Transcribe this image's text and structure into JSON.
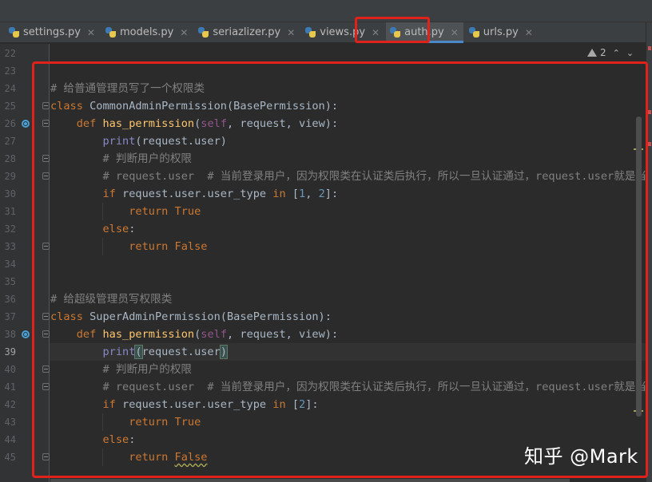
{
  "tabs": [
    {
      "label": "settings.py",
      "active": false
    },
    {
      "label": "models.py",
      "active": false
    },
    {
      "label": "seriazlizer.py",
      "active": false
    },
    {
      "label": "views.py",
      "active": false
    },
    {
      "label": "auth.py",
      "active": true
    },
    {
      "label": "urls.py",
      "active": false
    }
  ],
  "inspections": {
    "warning_count": "2"
  },
  "gutter": {
    "line_numbers": [
      "22",
      "23",
      "24",
      "25",
      "26",
      "27",
      "28",
      "29",
      "30",
      "31",
      "32",
      "33",
      "34",
      "35",
      "36",
      "37",
      "38",
      "39",
      "40",
      "41",
      "42",
      "43",
      "44",
      "45"
    ],
    "current_line": "39"
  },
  "code": {
    "l24": {
      "comment": "# 给普通管理员写了一个权限类"
    },
    "l25": {
      "kw": "class",
      "name": "CommonAdminPermission",
      "base": "(BasePermission):"
    },
    "l26": {
      "kw": "def",
      "fn": "has_permission",
      "p1": "self",
      "p2": ", request, view):"
    },
    "l27": {
      "bi": "print",
      "args": "(request.user)"
    },
    "l28": {
      "comment": "# 判断用户的权限"
    },
    "l29": {
      "comment": "# request.user  # 当前登录用户，因为权限类在认证类后执行，所以一旦认证通过，request.user就是当前登"
    },
    "l30": {
      "kw": "if",
      "expr": "request.user.user_type",
      "in": "in",
      "lb": "[",
      "n1": "1",
      "sep": ", ",
      "n2": "2",
      "rb": "]:"
    },
    "l31": {
      "kw": "return",
      "val": "True"
    },
    "l32": {
      "kw": "else",
      "colon": ":"
    },
    "l33": {
      "kw": "return",
      "val": "False"
    },
    "l36": {
      "comment": "# 给超级管理员写权限类"
    },
    "l37": {
      "kw": "class",
      "name": "SuperAdminPermission",
      "base": "(BasePermission):"
    },
    "l38": {
      "kw": "def",
      "fn": "has_permission",
      "p1": "self",
      "p2": ", request, view):"
    },
    "l39": {
      "bi": "print",
      "open": "(",
      "args": "request.user",
      "close": ")"
    },
    "l40": {
      "comment": "# 判断用户的权限"
    },
    "l41": {
      "comment": "# request.user  # 当前登录用户，因为权限类在认证类后执行，所以一旦认证通过，request.user就是当前登"
    },
    "l42": {
      "kw": "if",
      "expr": "request.user.user_type",
      "in": "in",
      "lb": "[",
      "n1": "2",
      "rb": "]:"
    },
    "l43": {
      "kw": "return",
      "val": "True"
    },
    "l44": {
      "kw": "else",
      "colon": ":"
    },
    "l45": {
      "kw": "return",
      "val": "False"
    }
  },
  "watermark": "知乎 @Mark",
  "colors": {
    "highlight_box": "#e0221b",
    "keyword": "#cc7832",
    "function": "#ffc66d",
    "comment": "#808080",
    "number": "#6897bb",
    "builtin": "#8888c6",
    "self": "#94558d"
  }
}
